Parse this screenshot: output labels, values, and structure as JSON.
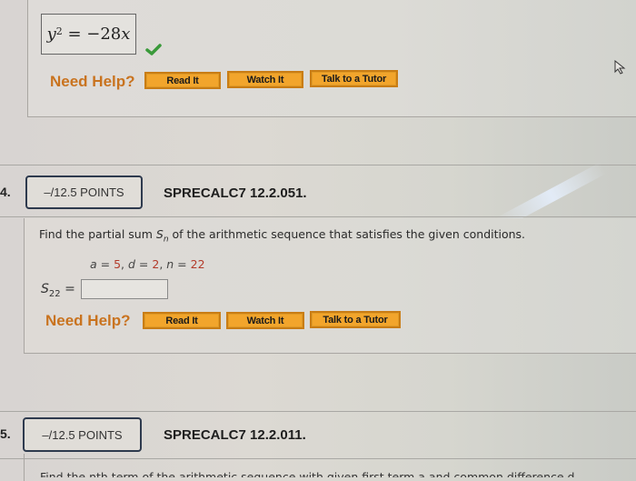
{
  "previous_question": {
    "answer": {
      "lhs_var": "y",
      "lhs_exponent": "2",
      "rhs": "= −28",
      "rhs_var": "x"
    },
    "correct_icon": "check-mark-icon",
    "need_help_label": "Need Help?",
    "buttons": {
      "read_it": "Read It",
      "watch_it": "Watch It",
      "talk_to_tutor": "Talk to a Tutor"
    }
  },
  "question_4": {
    "number": "4.",
    "points": "–/12.5 POINTS",
    "code": "SPRECALC7 12.2.051.",
    "prompt_before": "Find the partial sum ",
    "prompt_var": "S",
    "prompt_sub": "n",
    "prompt_after": " of the arithmetic sequence that satisfies the given conditions.",
    "conditions": {
      "a_label": "a",
      "a_value": "5",
      "d_label": "d",
      "d_value": "2",
      "n_label": "n",
      "n_value": "22"
    },
    "answer_label_var": "S",
    "answer_label_sub": "22",
    "answer_value": "",
    "need_help_label": "Need Help?",
    "buttons": {
      "read_it": "Read It",
      "watch_it": "Watch It",
      "talk_to_tutor": "Talk to a Tutor"
    }
  },
  "question_5": {
    "number": "5.",
    "points": "–/12.5 POINTS",
    "code": "SPRECALC7 12.2.011.",
    "prompt_partial": "Find the nth term of the arithmetic sequence with given first term a and common difference d."
  },
  "colors": {
    "need_help": "#c9731f",
    "button_fill": "#f2a52c",
    "button_border": "#c97d15",
    "check": "#3a9a3a",
    "condition_value": "#b33a2a",
    "points_border": "#2e3a4e"
  }
}
